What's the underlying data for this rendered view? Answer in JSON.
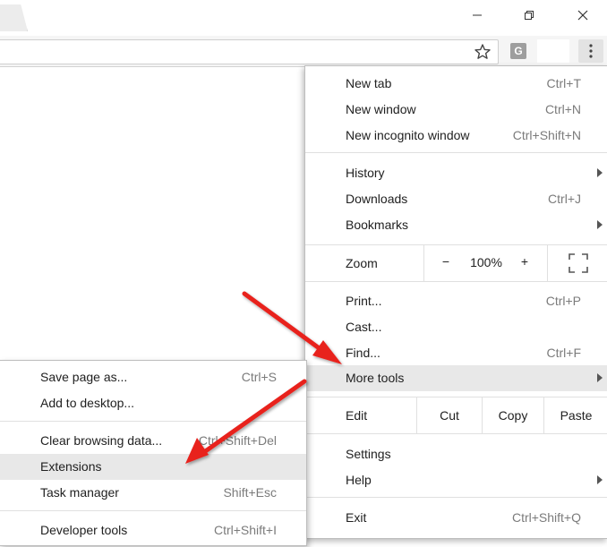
{
  "window": {
    "minimize_icon": "minimize-icon",
    "restore_icon": "restore-icon",
    "close_icon": "close-icon"
  },
  "toolbar": {
    "bookmark_icon": "star-icon",
    "extension_letter": "G",
    "menu_icon": "vertical-ellipsis-icon"
  },
  "menu": {
    "new_tab": {
      "label": "New tab",
      "shortcut": "Ctrl+T"
    },
    "new_window": {
      "label": "New window",
      "shortcut": "Ctrl+N"
    },
    "new_incognito": {
      "label": "New incognito window",
      "shortcut": "Ctrl+Shift+N"
    },
    "history": {
      "label": "History"
    },
    "downloads": {
      "label": "Downloads",
      "shortcut": "Ctrl+J"
    },
    "bookmarks": {
      "label": "Bookmarks"
    },
    "zoom": {
      "label": "Zoom",
      "minus": "−",
      "value": "100%",
      "plus": "+"
    },
    "print": {
      "label": "Print...",
      "shortcut": "Ctrl+P"
    },
    "cast": {
      "label": "Cast..."
    },
    "find": {
      "label": "Find...",
      "shortcut": "Ctrl+F"
    },
    "more_tools": {
      "label": "More tools"
    },
    "edit": {
      "label": "Edit",
      "cut": "Cut",
      "copy": "Copy",
      "paste": "Paste"
    },
    "settings": {
      "label": "Settings"
    },
    "help": {
      "label": "Help"
    },
    "exit": {
      "label": "Exit",
      "shortcut": "Ctrl+Shift+Q"
    }
  },
  "submenu": {
    "save_page": {
      "label": "Save page as...",
      "shortcut": "Ctrl+S"
    },
    "add_desktop": {
      "label": "Add to desktop..."
    },
    "clear_data": {
      "label": "Clear browsing data...",
      "shortcut": "Ctrl+Shift+Del"
    },
    "extensions": {
      "label": "Extensions"
    },
    "task_manager": {
      "label": "Task manager",
      "shortcut": "Shift+Esc"
    },
    "dev_tools": {
      "label": "Developer tools",
      "shortcut": "Ctrl+Shift+I"
    }
  },
  "colors": {
    "highlight": "#e8e8e8",
    "arrow": "#e8201e"
  }
}
